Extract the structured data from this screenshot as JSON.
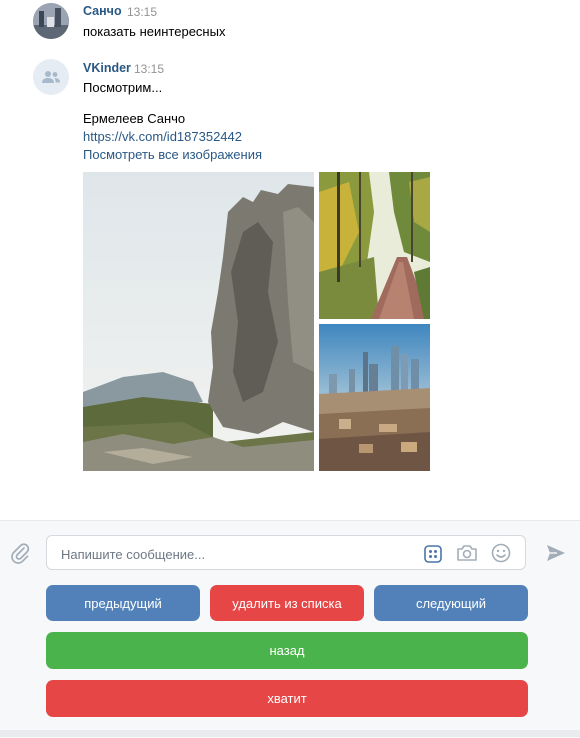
{
  "messages": [
    {
      "author": "Санчо",
      "time": "13:15",
      "text": "показать неинтересных"
    },
    {
      "author": "VKinder",
      "time": "13:15",
      "text": "Посмотрим...",
      "person_name": "Ермелеев Санчо",
      "profile_link": "https://vk.com/id187352442",
      "all_images_link": "Посмотреть все изображения",
      "photos": [
        "mountain-rock-photo",
        "forest-path-photo",
        "city-skyline-photo"
      ]
    }
  ],
  "composer": {
    "placeholder": "Напишите сообщение...",
    "icons": [
      "attach-icon",
      "keyboard-icon",
      "camera-icon",
      "emoji-icon",
      "send-icon"
    ]
  },
  "keyboard": {
    "row1": [
      "предыдущий",
      "удалить из списка",
      "следующий"
    ],
    "row2": "назад",
    "row3": "хватит"
  },
  "colors": {
    "link": "#2a5885",
    "blue_button": "#5181b8",
    "red_button": "#e64646",
    "green_button": "#4bb34b",
    "time": "#939393"
  }
}
